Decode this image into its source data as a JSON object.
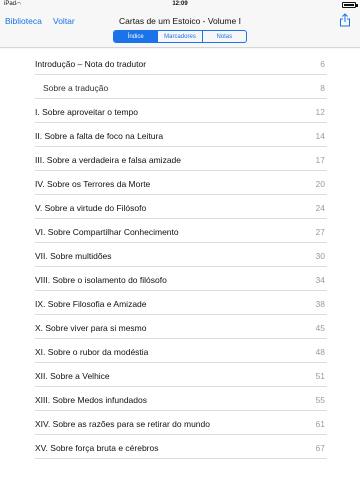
{
  "status_bar": {
    "carrier": "iPad",
    "time": "12:09"
  },
  "nav": {
    "library_label": "Biblioteca",
    "back_label": "Voltar",
    "title": "Cartas de um Estoico - Volume I"
  },
  "tabs": [
    {
      "label": "Índice",
      "active": true
    },
    {
      "label": "Marcadores",
      "active": false
    },
    {
      "label": "Notas",
      "active": false
    }
  ],
  "toc": [
    {
      "title": "Introdução – Nota do tradutor",
      "page": "6",
      "sub": false
    },
    {
      "title": "Sobre a tradução",
      "page": "8",
      "sub": true
    },
    {
      "title": "I. Sobre aproveitar o tempo",
      "page": "12",
      "sub": false
    },
    {
      "title": "II. Sobre a falta de foco na Leitura",
      "page": "14",
      "sub": false
    },
    {
      "title": "III. Sobre a verdadeira e falsa amizade",
      "page": "17",
      "sub": false
    },
    {
      "title": "IV. Sobre os Terrores da Morte",
      "page": "20",
      "sub": false
    },
    {
      "title": "V. Sobre a virtude do Filósofo",
      "page": "24",
      "sub": false
    },
    {
      "title": "VI. Sobre Compartilhar Conhecimento",
      "page": "27",
      "sub": false
    },
    {
      "title": "VII. Sobre multidões",
      "page": "30",
      "sub": false
    },
    {
      "title": "VIII. Sobre o isolamento do filósofo",
      "page": "34",
      "sub": false
    },
    {
      "title": "IX. Sobre Filosofia e Amizade",
      "page": "38",
      "sub": false
    },
    {
      "title": "X. Sobre viver para si mesmo",
      "page": "45",
      "sub": false
    },
    {
      "title": "XI. Sobre o rubor da modéstia",
      "page": "48",
      "sub": false
    },
    {
      "title": "XII. Sobre a Velhice",
      "page": "51",
      "sub": false
    },
    {
      "title": "XIII. Sobre Medos infundados",
      "page": "55",
      "sub": false
    },
    {
      "title": "XIV. Sobre as razões para se retirar do mundo",
      "page": "61",
      "sub": false
    },
    {
      "title": "XV. Sobre força bruta e cérebros",
      "page": "67",
      "sub": false
    }
  ]
}
